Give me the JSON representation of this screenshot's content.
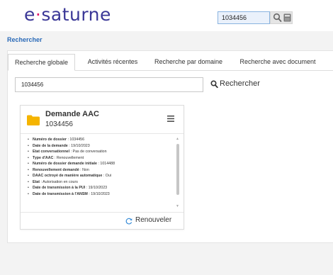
{
  "header": {
    "logo_text": "e·saturne",
    "search_value": "1034456",
    "search_icon": "search-icon",
    "calc_icon": "calculator-icon"
  },
  "breadcrumb": {
    "link": "Rechercher"
  },
  "tabs": [
    {
      "label": "Recherche globale",
      "active": true
    },
    {
      "label": "Activités récentes",
      "active": false
    },
    {
      "label": "Recherche par domaine",
      "active": false
    },
    {
      "label": "Recherche avec document",
      "active": false
    }
  ],
  "search": {
    "query": "1034456",
    "button_label": "Rechercher"
  },
  "card": {
    "title": "Demande AAC",
    "number": "1034456",
    "details": [
      {
        "key": "Numéro de dossier",
        "value": "1034456"
      },
      {
        "key": "Date de la demande",
        "value": "19/10/2023"
      },
      {
        "key": "Etat conversationnel",
        "value": "Pas de conversation"
      },
      {
        "key": "Type d'AAC",
        "value": "Renouvellement"
      },
      {
        "key": "Numéro de dossier demande initiale",
        "value": "1014488"
      },
      {
        "key": "Renouvellement demandé",
        "value": "Non"
      },
      {
        "key": "DAAC octroyé de manière automatique",
        "value": "Oui"
      },
      {
        "key": "Etat",
        "value": "Autorisation en cours"
      },
      {
        "key": "Date de transmission à la PUI",
        "value": "19/10/2023"
      },
      {
        "key": "Date de transmission à l'ANSM",
        "value": "19/10/2023"
      }
    ],
    "action_label": "Renouveler"
  },
  "colors": {
    "brand_blue": "#3a3797",
    "brand_pink": "#e21b6b",
    "link_blue": "#2a6ab8",
    "folder_yellow": "#f5b400",
    "refresh_blue": "#3b8ed8"
  }
}
